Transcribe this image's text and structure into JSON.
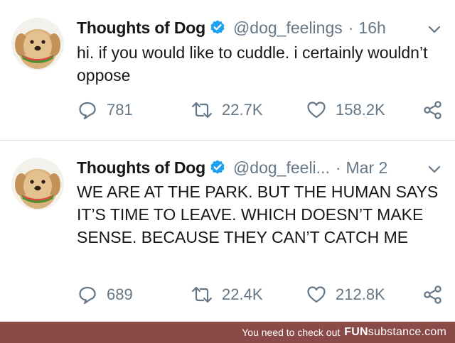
{
  "tweets": [
    {
      "display_name": "Thoughts of Dog",
      "handle": "@dog_feelings",
      "separator": "·",
      "time": "16h",
      "text": "hi. if you would like to cuddle. i certainly wouldn’t oppose",
      "replies": "781",
      "retweets": "22.7K",
      "likes": "158.2K"
    },
    {
      "display_name": "Thoughts of Dog",
      "handle": "@dog_feeli...",
      "separator": "·",
      "time": "Mar 2",
      "text": "WE ARE AT THE PARK. BUT THE HUMAN SAYS IT’S TIME TO LEAVE. WHICH DOESN’T MAKE SENSE. BECAUSE THEY CAN’T CATCH ME",
      "replies": "689",
      "retweets": "22.4K",
      "likes": "212.8K"
    }
  ],
  "icons": {
    "verified": "verified-badge-icon",
    "caret": "chevron-down-icon",
    "reply": "reply-bubble-icon",
    "retweet": "retweet-icon",
    "like": "heart-icon",
    "share": "share-icon"
  },
  "colors": {
    "verified_blue": "#1da1f2",
    "secondary_text": "#657786",
    "primary_text": "#14171a",
    "footer_bg": "#8a4a48"
  },
  "footer": {
    "prefix": "You need to check out",
    "brand_bold": "FUN",
    "brand_rest": "substance",
    "brand_suffix": ".com"
  }
}
